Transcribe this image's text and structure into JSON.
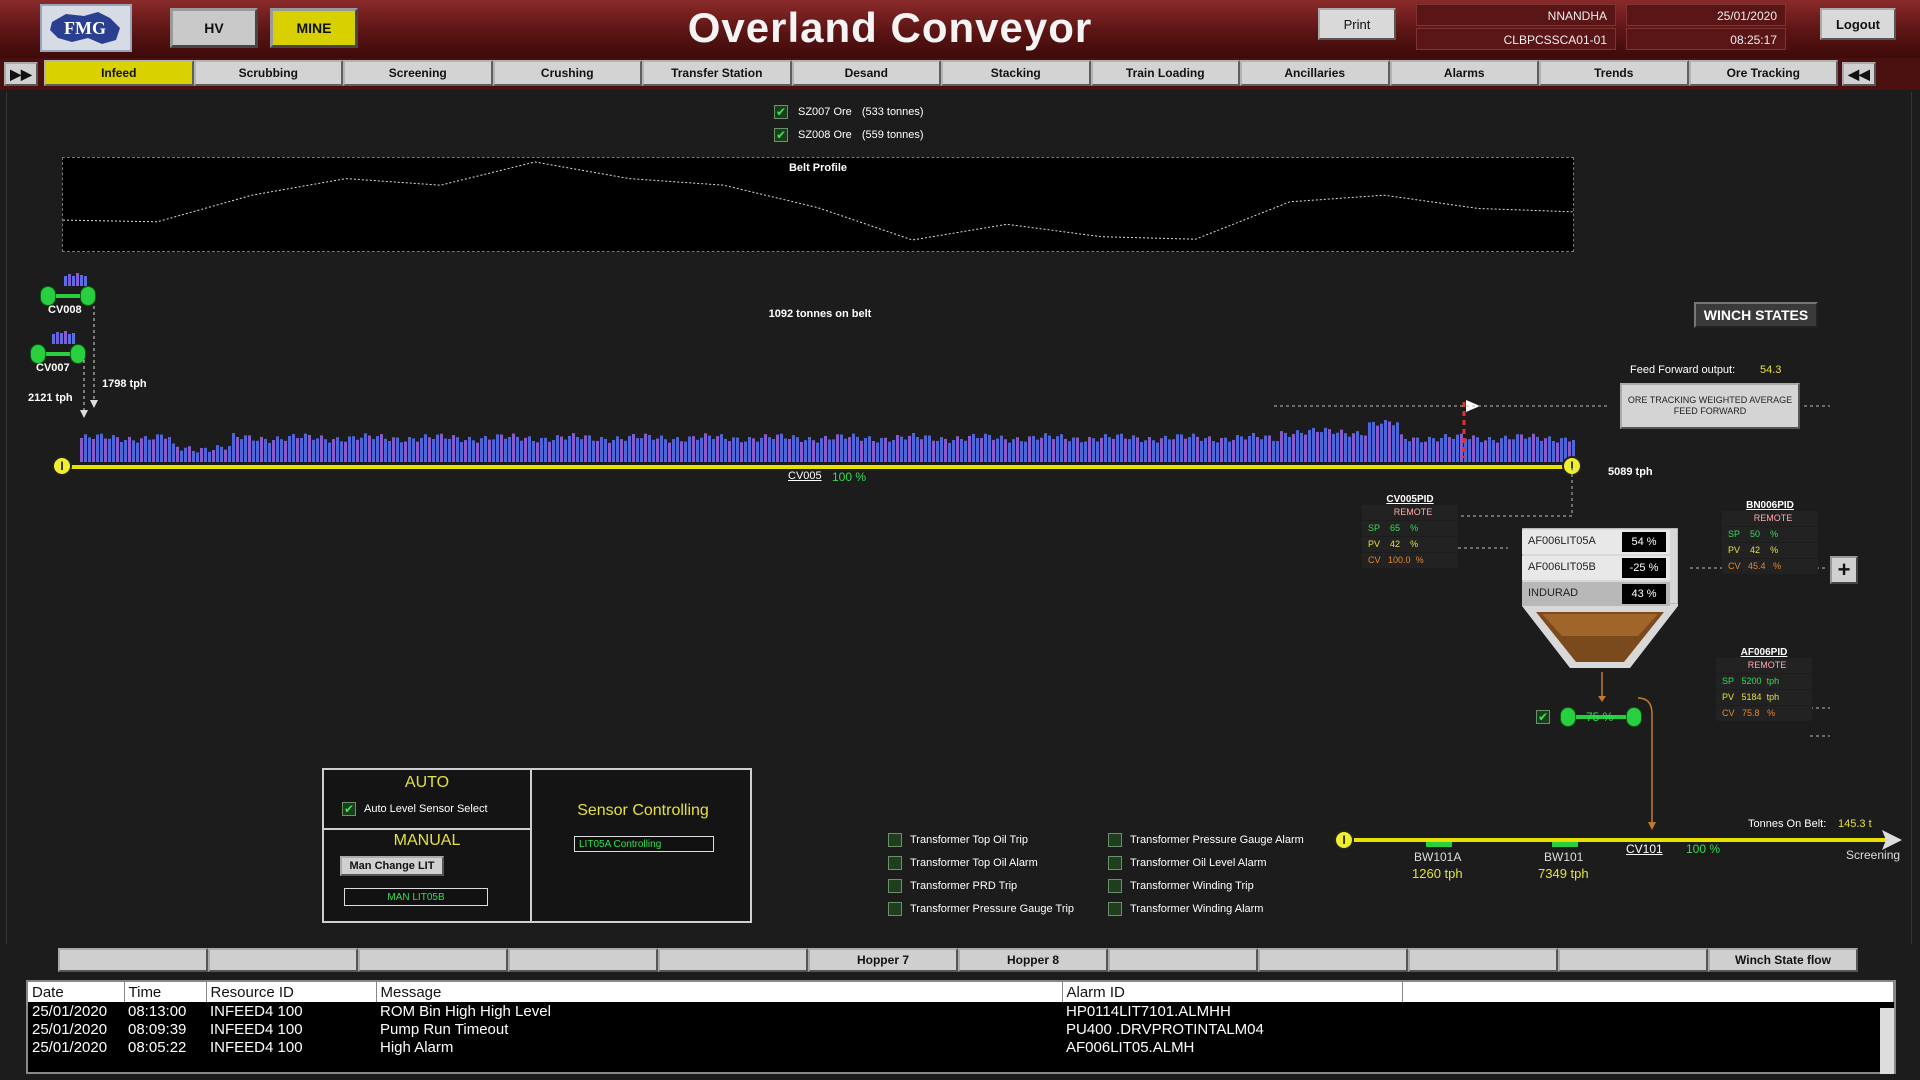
{
  "header": {
    "logo_text": "FMG",
    "hv_label": "HV",
    "mine_label": "MINE",
    "title": "Overland Conveyor",
    "print_label": "Print",
    "user": "NNANDHA",
    "date": "25/01/2020",
    "host": "CLBPCSSCA01-01",
    "time": "08:25:17",
    "logout_label": "Logout"
  },
  "nav": {
    "left_arrow": "▶▶",
    "right_arrow": "◀◀",
    "tabs": [
      "Infeed",
      "Scrubbing",
      "Screening",
      "Crushing",
      "Transfer Station",
      "Desand",
      "Stacking",
      "Train Loading",
      "Ancillaries",
      "Alarms",
      "Trends",
      "Ore Tracking"
    ]
  },
  "ore": {
    "sz007": "SZ007 Ore",
    "sz007_t": "(533 tonnes)",
    "sz008": "SZ008 Ore",
    "sz008_t": "(559 tonnes)"
  },
  "belt_profile_title": "Belt Profile",
  "belt_profile": [
    0.7,
    0.72,
    0.4,
    0.2,
    0.28,
    0.0,
    0.2,
    0.28,
    0.55,
    0.94,
    0.75,
    0.9,
    0.93,
    0.48,
    0.4,
    0.56,
    0.6
  ],
  "tonnes_on_belt": "1092 tonnes on belt",
  "conveyors": {
    "cv008": "CV008",
    "cv007": "CV007",
    "tph_2121": "2121 tph",
    "tph_1798": "1798 tph",
    "cv005": "CV005",
    "cv005_pct": "100 %",
    "tph_5089": "5089 tph",
    "pin": "I"
  },
  "winch_states": "WINCH STATES",
  "feed_forward": {
    "label": "Feed Forward output:",
    "value": "54.3",
    "button": "ORE TRACKING WEIGHTED AVERAGE FEED FORWARD"
  },
  "pids": {
    "cv005": {
      "name": "CV005PID",
      "mode": "REMOTE",
      "sp": "SP",
      "sp_val": "65",
      "sp_unit": "%",
      "pv": "PV",
      "pv_val": "42",
      "pv_unit": "%",
      "cv": "CV",
      "cv_val": "100.0",
      "cv_unit": "%"
    },
    "bn006": {
      "name": "BN006PID",
      "mode": "REMOTE",
      "sp": "SP",
      "sp_val": "50",
      "sp_unit": "%",
      "pv": "PV",
      "pv_val": "42",
      "pv_unit": "%",
      "cv": "CV",
      "cv_val": "45.4",
      "cv_unit": "%"
    },
    "af006": {
      "name": "AF006PID",
      "mode": "REMOTE",
      "sp": "SP",
      "sp_val": "5200",
      "sp_unit": "tph",
      "pv": "PV",
      "pv_val": "5184",
      "pv_unit": "tph",
      "cv": "CV",
      "cv_val": "75.8",
      "cv_unit": "%"
    }
  },
  "hopper": {
    "lit05a": "AF006LIT05A",
    "lit05a_val": "54 %",
    "lit05b": "AF006LIT05B",
    "lit05b_val": "-25 %",
    "indurad": "INDURAD",
    "indurad_val": "43 %"
  },
  "feeder_pct": "75 %",
  "plus_label": "+",
  "control": {
    "auto": "AUTO",
    "auto_sensor": "Auto Level Sensor Select",
    "manual": "MANUAL",
    "man_change": "Man Change LIT",
    "man_lit": "MAN LIT05B",
    "sensor_title": "Sensor Controlling",
    "sensor_value": "LIT05A Controlling"
  },
  "transformer_alarms": {
    "left": [
      "Transformer Top Oil Trip",
      "Transformer Top Oil Alarm",
      "Transformer PRD Trip",
      "Transformer Pressure Gauge Trip"
    ],
    "right": [
      "Transformer Pressure Gauge Alarm",
      "Transformer Oil Level Alarm",
      "Transformer Winding Trip",
      "Transformer Winding Alarm"
    ]
  },
  "cv101": {
    "tonnes_label": "Tonnes On Belt:",
    "tonnes_val": "145.3 t",
    "name": "CV101",
    "pct": "100 %",
    "screening": "Screening",
    "bw101a": "BW101A",
    "bw101a_tph": "1260 tph",
    "bw101": "BW101",
    "bw101_tph": "7349 tph"
  },
  "hopper_tabs": [
    "",
    "",
    "",
    "",
    "",
    "Hopper 7",
    "Hopper 8",
    "",
    "",
    "",
    "",
    "Winch State flow"
  ],
  "alarm_table": {
    "headers": [
      "Date",
      "Time",
      "Resource ID",
      "Message",
      "Alarm ID",
      ""
    ],
    "rows": [
      [
        "25/01/2020",
        "08:13:00",
        "INFEED4 100",
        "ROM Bin High High Level",
        "HP0114LIT7101.ALMHH",
        ""
      ],
      [
        "25/01/2020",
        "08:09:39",
        "INFEED4 100",
        "Pump Run Timeout",
        "PU400 .DRVPROTINTALM04",
        ""
      ],
      [
        "25/01/2020",
        "08:05:22",
        "INFEED4 100",
        "High Alarm",
        "AF006LIT05.ALMH",
        ""
      ]
    ]
  },
  "colors": {
    "header_red": "#5b1414",
    "active_tab": "#d9d200",
    "belt_yellow": "#e8e000",
    "run_green": "#28d040"
  }
}
